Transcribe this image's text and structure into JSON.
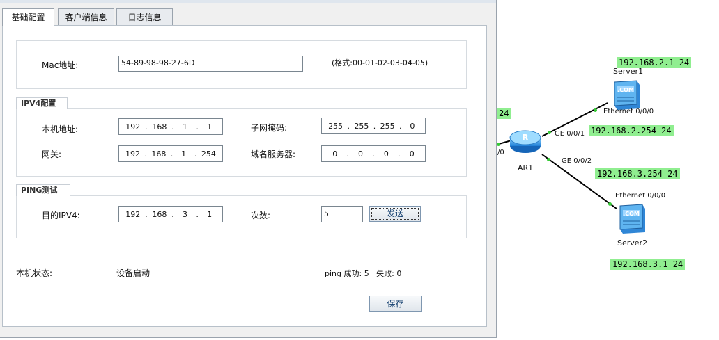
{
  "tabs": [
    "基础配置",
    "客户端信息",
    "日志信息"
  ],
  "mac": {
    "label": "Mac地址:",
    "value": "54-89-98-98-27-6D",
    "hint": "(格式:00-01-02-03-04-05)"
  },
  "ipv4": {
    "title": "IPV4配置",
    "local_label": "本机地址:",
    "local": [
      "192",
      "168",
      "1",
      "1"
    ],
    "mask_label": "子网掩码:",
    "mask": [
      "255",
      "255",
      "255",
      "0"
    ],
    "gateway_label": "网关:",
    "gateway": [
      "192",
      "168",
      "1",
      "254"
    ],
    "dns_label": "域名服务器:",
    "dns": [
      "0",
      "0",
      "0",
      "0"
    ]
  },
  "ping": {
    "title": "PING测试",
    "dest_label": "目的IPV4:",
    "dest": [
      "192",
      "168",
      "3",
      "1"
    ],
    "count_label": "次数:",
    "count": "5",
    "send_button": "发送"
  },
  "status": {
    "label": "本机状态:",
    "value": "设备启动",
    "ping_result": "ping 成功: 5   失败: 0"
  },
  "save_button": "保存",
  "topology": {
    "router": "AR1",
    "router_ports": [
      "GE 0/0/1",
      "GE 0/0/2"
    ],
    "partial_port": "/0",
    "partial_ip": "24",
    "server1": {
      "name": "Server1",
      "port": "Ethernet 0/0/0",
      "ip": "192.168.2.1 24"
    },
    "server2": {
      "name": "Server2",
      "port": "Ethernet 0/0/0",
      "ip": "192.168.3.1 24"
    },
    "link_ips": [
      "192.168.2.254 24",
      "192.168.3.254 24"
    ],
    "colors": {
      "ip_highlight": "#90ee90",
      "link_node": "#35c935"
    }
  }
}
